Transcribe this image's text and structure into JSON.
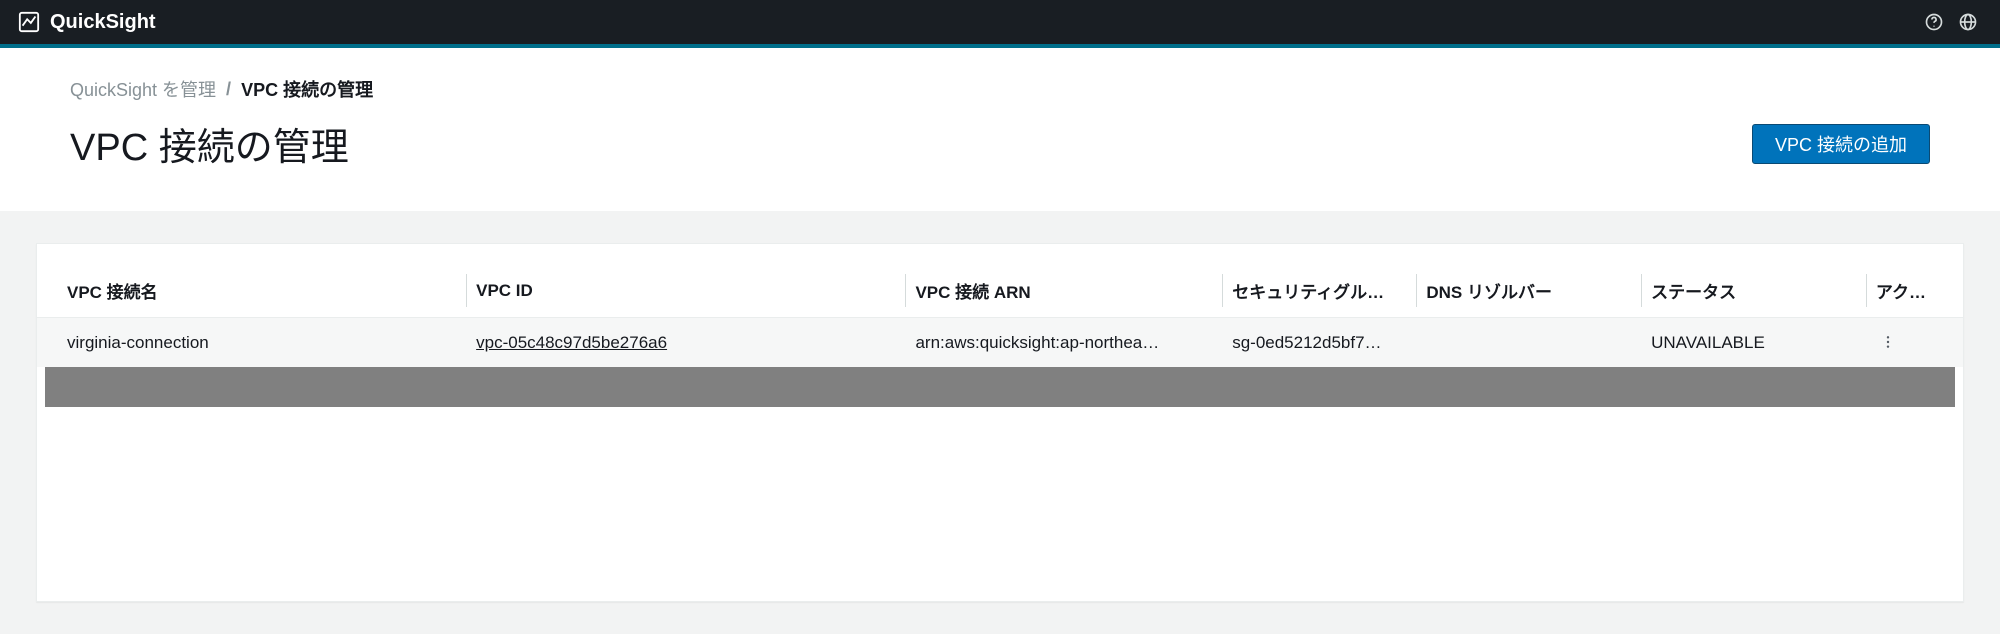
{
  "brand": {
    "name": "QuickSight"
  },
  "breadcrumb": {
    "parent": "QuickSight を管理",
    "sep": "/",
    "current": "VPC 接続の管理"
  },
  "page": {
    "title": "VPC 接続の管理",
    "add_button": "VPC 接続の追加"
  },
  "table": {
    "columns": {
      "name": "VPC 接続名",
      "vpcid": "VPC ID",
      "arn": "VPC 接続 ARN",
      "sg": "セキュリティグル…",
      "dns": "DNS リゾルバー",
      "status": "ステータス",
      "act": "アク…"
    },
    "rows": [
      {
        "name": "virginia-connection",
        "vpcid": "vpc-05c48c97d5be276a6",
        "arn": "arn:aws:quicksight:ap-northea…",
        "sg": "sg-0ed5212d5bf7…",
        "dns": "",
        "status": "UNAVAILABLE"
      }
    ]
  }
}
